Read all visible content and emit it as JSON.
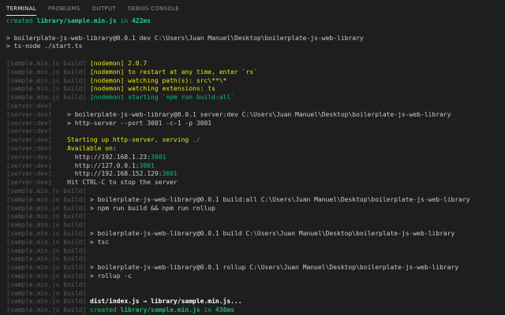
{
  "tabs": [
    "TERMINAL",
    "PROBLEMS",
    "OUTPUT",
    "DEBUG CONSOLE"
  ],
  "active_tab": 0,
  "lines": [
    [
      {
        "t": "created ",
        "c": "g"
      },
      {
        "t": "library/sample.min.js",
        "c": "bg"
      },
      {
        "t": " in ",
        "c": "g"
      },
      {
        "t": "422ms",
        "c": "bg"
      }
    ],
    [],
    [
      {
        "t": "> boilerplate-js-web-library@0.0.1 dev C:\\Users\\Juan Manuel\\Desktop\\boilerplate-js-web-library",
        "c": "w"
      }
    ],
    [
      {
        "t": "> ts-node ./start.ts",
        "c": "w"
      }
    ],
    [],
    [
      {
        "t": "[sample.min.js build] ",
        "c": "p"
      },
      {
        "t": "[nodemon] 2.0.7",
        "c": "y"
      }
    ],
    [
      {
        "t": "[sample.min.js build] ",
        "c": "p"
      },
      {
        "t": "[nodemon] to restart at any time, enter `rs`",
        "c": "y"
      }
    ],
    [
      {
        "t": "[sample.min.js build] ",
        "c": "p"
      },
      {
        "t": "[nodemon] watching path(s): src\\**\\*",
        "c": "y"
      }
    ],
    [
      {
        "t": "[sample.min.js build] ",
        "c": "p"
      },
      {
        "t": "[nodemon] watching extensions: ts",
        "c": "y"
      }
    ],
    [
      {
        "t": "[sample.min.js build] ",
        "c": "p"
      },
      {
        "t": "[nodemon] starting `npm run build:all`",
        "c": "g"
      }
    ],
    [
      {
        "t": "[server:dev]",
        "c": "p"
      }
    ],
    [
      {
        "t": "[server:dev]    ",
        "c": "p"
      },
      {
        "t": "> boilerplate-js-web-library@0.0.1 server:dev C:\\Users\\Juan Manuel\\Desktop\\boilerplate-js-web-library",
        "c": "w"
      }
    ],
    [
      {
        "t": "[server:dev]    ",
        "c": "p"
      },
      {
        "t": "> http-server --port 3001 -c-1 -p 3001",
        "c": "w"
      }
    ],
    [
      {
        "t": "[server:dev]",
        "c": "p"
      }
    ],
    [
      {
        "t": "[server:dev]    ",
        "c": "p"
      },
      {
        "t": "Starting up http-server, serving ",
        "c": "y"
      },
      {
        "t": "./",
        "c": "g"
      }
    ],
    [
      {
        "t": "[server:dev]    ",
        "c": "p"
      },
      {
        "t": "Available on:",
        "c": "y"
      }
    ],
    [
      {
        "t": "[server:dev]    ",
        "c": "p"
      },
      {
        "t": "  http://192.168.1.23:",
        "c": "w"
      },
      {
        "t": "3001",
        "c": "g"
      }
    ],
    [
      {
        "t": "[server:dev]    ",
        "c": "p"
      },
      {
        "t": "  http://127.0.0.1:",
        "c": "w"
      },
      {
        "t": "3001",
        "c": "g"
      }
    ],
    [
      {
        "t": "[server:dev]    ",
        "c": "p"
      },
      {
        "t": "  http://192.168.152.129:",
        "c": "w"
      },
      {
        "t": "3001",
        "c": "g"
      }
    ],
    [
      {
        "t": "[server:dev]    ",
        "c": "p"
      },
      {
        "t": "Hit CTRL-C to stop the server",
        "c": "w"
      }
    ],
    [
      {
        "t": "[sample.min.js build]",
        "c": "p"
      }
    ],
    [
      {
        "t": "[sample.min.js build] ",
        "c": "p"
      },
      {
        "t": "> boilerplate-js-web-library@0.0.1 build:all C:\\Users\\Juan Manuel\\Desktop\\boilerplate-js-web-library",
        "c": "w"
      }
    ],
    [
      {
        "t": "[sample.min.js build] ",
        "c": "p"
      },
      {
        "t": "> npm run build && npm run rollup",
        "c": "w"
      }
    ],
    [
      {
        "t": "[sample.min.js build]",
        "c": "p"
      }
    ],
    [
      {
        "t": "[sample.min.js build]",
        "c": "p"
      }
    ],
    [
      {
        "t": "[sample.min.js build] ",
        "c": "p"
      },
      {
        "t": "> boilerplate-js-web-library@0.0.1 build C:\\Users\\Juan Manuel\\Desktop\\boilerplate-js-web-library",
        "c": "w"
      }
    ],
    [
      {
        "t": "[sample.min.js build] ",
        "c": "p"
      },
      {
        "t": "> tsc",
        "c": "w"
      }
    ],
    [
      {
        "t": "[sample.min.js build]",
        "c": "p"
      }
    ],
    [
      {
        "t": "[sample.min.js build]",
        "c": "p"
      }
    ],
    [
      {
        "t": "[sample.min.js build] ",
        "c": "p"
      },
      {
        "t": "> boilerplate-js-web-library@0.0.1 rollup C:\\Users\\Juan Manuel\\Desktop\\boilerplate-js-web-library",
        "c": "w"
      }
    ],
    [
      {
        "t": "[sample.min.js build] ",
        "c": "p"
      },
      {
        "t": "> rollup -c",
        "c": "w"
      }
    ],
    [
      {
        "t": "[sample.min.js build]",
        "c": "p"
      }
    ],
    [
      {
        "t": "[sample.min.js build]",
        "c": "p"
      }
    ],
    [
      {
        "t": "[sample.min.js build] ",
        "c": "p"
      },
      {
        "t": "dist/index.js → library/sample.min.js...",
        "c": "b"
      }
    ],
    [
      {
        "t": "[sample.min.js build] ",
        "c": "p"
      },
      {
        "t": "created ",
        "c": "g"
      },
      {
        "t": "library/sample.min.js",
        "c": "bb"
      },
      {
        "t": " in ",
        "c": "g"
      },
      {
        "t": "438ms",
        "c": "bb"
      }
    ]
  ]
}
